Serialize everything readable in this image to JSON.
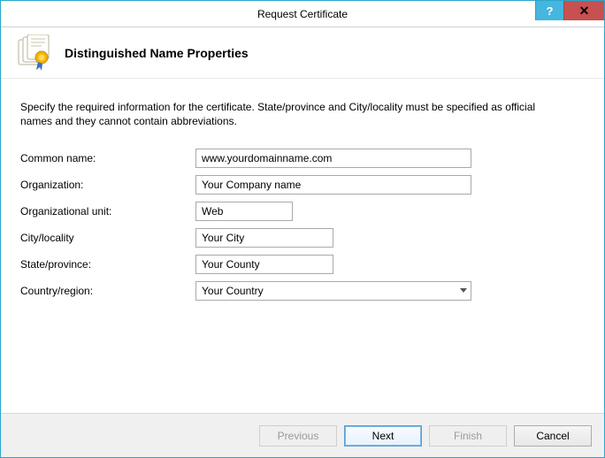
{
  "window": {
    "title": "Request Certificate",
    "help_symbol": "?",
    "close_symbol": "✕"
  },
  "header": {
    "title": "Distinguished Name Properties"
  },
  "body": {
    "instructions": "Specify the required information for the certificate. State/province and City/locality must be specified as official names and they cannot contain abbreviations."
  },
  "fields": {
    "common_name": {
      "label": "Common name:",
      "value": "www.yourdomainname.com"
    },
    "organization": {
      "label": "Organization:",
      "value": "Your Company name"
    },
    "org_unit": {
      "label": "Organizational unit:",
      "value": "Web"
    },
    "city": {
      "label": "City/locality",
      "value": "Your City"
    },
    "state": {
      "label": "State/province:",
      "value": "Your County"
    },
    "country": {
      "label": "Country/region:",
      "value": "Your Country"
    }
  },
  "buttons": {
    "previous": "Previous",
    "next": "Next",
    "finish": "Finish",
    "cancel": "Cancel"
  }
}
